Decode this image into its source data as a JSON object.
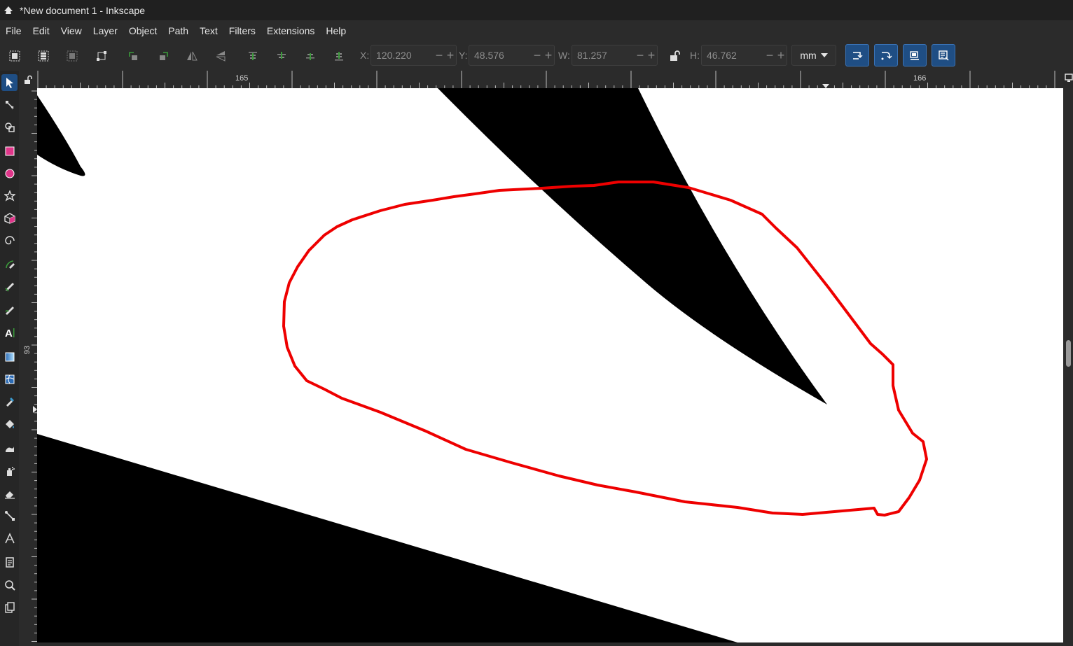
{
  "window": {
    "title": "*New document 1 - Inkscape"
  },
  "menu": [
    "File",
    "Edit",
    "View",
    "Layer",
    "Object",
    "Path",
    "Text",
    "Filters",
    "Extensions",
    "Help"
  ],
  "toolbar": {
    "x_label": "X:",
    "x_value": "120.220",
    "y_label": "Y:",
    "y_value": "48.576",
    "w_label": "W:",
    "w_value": "81.257",
    "h_label": "H:",
    "h_value": "46.762",
    "unit": "mm"
  },
  "rulers": {
    "h_label_1": "165",
    "h_label_2": "166",
    "v_label_1": "93"
  },
  "colors": {
    "selection_outline": "#ee0000",
    "tool_active": "#1f4e84",
    "tool_fill": "#e0368a"
  },
  "tools": [
    "selector-icon",
    "node-icon",
    "shape-builder-icon",
    "rectangle-icon",
    "ellipse-icon",
    "star-icon",
    "3d-box-icon",
    "spiral-icon",
    "pen-icon",
    "pencil-icon",
    "calligraphy-icon",
    "text-icon",
    "gradient-icon",
    "mesh-icon",
    "dropper-icon",
    "paint-bucket-icon",
    "tweak-icon",
    "spray-icon",
    "eraser-icon",
    "connector-icon",
    "measure-icon",
    "pages-icon",
    "zoom-icon",
    "document-icon"
  ]
}
